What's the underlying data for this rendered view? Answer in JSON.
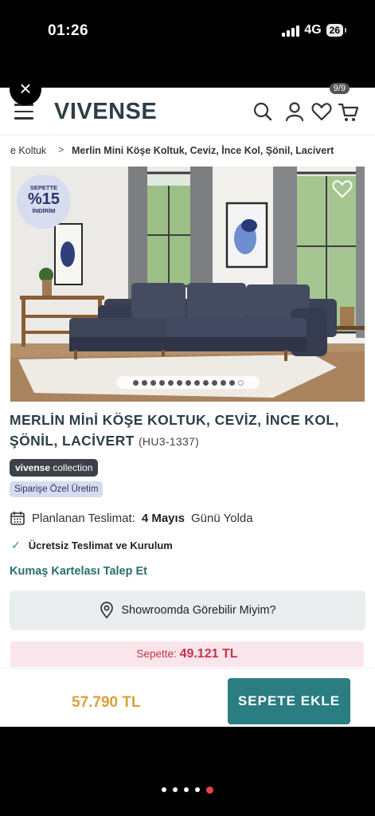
{
  "status_bar": {
    "time": "01:26",
    "network": "4G",
    "battery": "26"
  },
  "overlay": {
    "close_icon": "close-icon",
    "page_counter": "9/9"
  },
  "header": {
    "logo": "VIVENSE",
    "icons": [
      "menu-icon",
      "search-icon",
      "user-icon",
      "heart-icon",
      "cart-icon"
    ]
  },
  "breadcrumb": {
    "previous": "e Koltuk",
    "separator": ">",
    "current": "Merlin Mini Köşe Koltuk, Ceviz, İnce Kol, Şönil, Lacivert"
  },
  "product_image": {
    "badge_top": "SEPETTE",
    "badge_percent": "%15",
    "badge_bottom": "İNDİRİM",
    "dot_count": 13,
    "active_dot": 12
  },
  "product": {
    "title": "MERLİN Mİnİ KÖŞE KOLTUK, CEVİZ, İNCE KOL, ŞÖNİL, LACİVERT",
    "sku": "(HU3-1337)",
    "collection_brand": "vivense",
    "collection_suffix": " collection",
    "special_tag": "Siparişe Özel Üretim",
    "delivery_label": "Planlanan Teslimat:",
    "delivery_date": "4 Mayıs",
    "delivery_suffix": "Günü Yolda",
    "free_shipping": "Ücretsiz Teslimat ve Kurulum",
    "fabric_link": "Kumaş Kartelası Talep Et",
    "showroom_label": "Showroomda Görebilir Miyim?"
  },
  "pricing": {
    "basket_label": "Sepette:",
    "basket_price": "49.121 TL",
    "price": "57.790 TL",
    "add_to_cart": "SEPETE EKLE"
  },
  "colors": {
    "brand": "#2d3e45",
    "accent_teal": "#2a7d81",
    "price_gold": "#d9a33a",
    "basket_red": "#c2344d"
  },
  "bottom_pager": {
    "count": 5,
    "active": 4
  }
}
